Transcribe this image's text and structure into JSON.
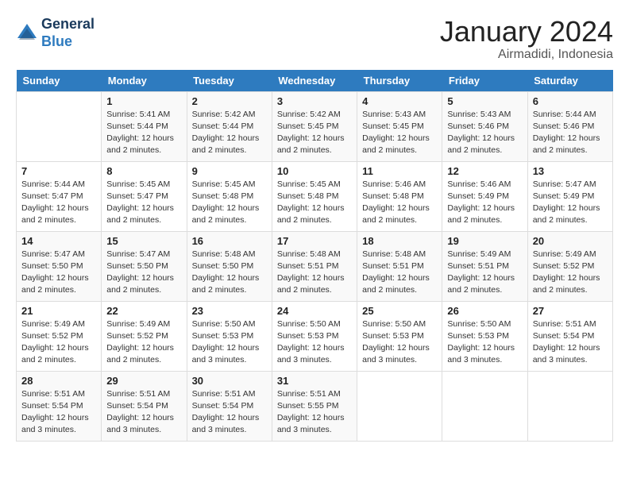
{
  "header": {
    "logo_line1": "General",
    "logo_line2": "Blue",
    "month": "January 2024",
    "location": "Airmadidi, Indonesia"
  },
  "weekdays": [
    "Sunday",
    "Monday",
    "Tuesday",
    "Wednesday",
    "Thursday",
    "Friday",
    "Saturday"
  ],
  "weeks": [
    [
      {
        "day": "",
        "info": ""
      },
      {
        "day": "1",
        "info": "Sunrise: 5:41 AM\nSunset: 5:44 PM\nDaylight: 12 hours\nand 2 minutes."
      },
      {
        "day": "2",
        "info": "Sunrise: 5:42 AM\nSunset: 5:44 PM\nDaylight: 12 hours\nand 2 minutes."
      },
      {
        "day": "3",
        "info": "Sunrise: 5:42 AM\nSunset: 5:45 PM\nDaylight: 12 hours\nand 2 minutes."
      },
      {
        "day": "4",
        "info": "Sunrise: 5:43 AM\nSunset: 5:45 PM\nDaylight: 12 hours\nand 2 minutes."
      },
      {
        "day": "5",
        "info": "Sunrise: 5:43 AM\nSunset: 5:46 PM\nDaylight: 12 hours\nand 2 minutes."
      },
      {
        "day": "6",
        "info": "Sunrise: 5:44 AM\nSunset: 5:46 PM\nDaylight: 12 hours\nand 2 minutes."
      }
    ],
    [
      {
        "day": "7",
        "info": "Sunrise: 5:44 AM\nSunset: 5:47 PM\nDaylight: 12 hours\nand 2 minutes."
      },
      {
        "day": "8",
        "info": "Sunrise: 5:45 AM\nSunset: 5:47 PM\nDaylight: 12 hours\nand 2 minutes."
      },
      {
        "day": "9",
        "info": "Sunrise: 5:45 AM\nSunset: 5:48 PM\nDaylight: 12 hours\nand 2 minutes."
      },
      {
        "day": "10",
        "info": "Sunrise: 5:45 AM\nSunset: 5:48 PM\nDaylight: 12 hours\nand 2 minutes."
      },
      {
        "day": "11",
        "info": "Sunrise: 5:46 AM\nSunset: 5:48 PM\nDaylight: 12 hours\nand 2 minutes."
      },
      {
        "day": "12",
        "info": "Sunrise: 5:46 AM\nSunset: 5:49 PM\nDaylight: 12 hours\nand 2 minutes."
      },
      {
        "day": "13",
        "info": "Sunrise: 5:47 AM\nSunset: 5:49 PM\nDaylight: 12 hours\nand 2 minutes."
      }
    ],
    [
      {
        "day": "14",
        "info": "Sunrise: 5:47 AM\nSunset: 5:50 PM\nDaylight: 12 hours\nand 2 minutes."
      },
      {
        "day": "15",
        "info": "Sunrise: 5:47 AM\nSunset: 5:50 PM\nDaylight: 12 hours\nand 2 minutes."
      },
      {
        "day": "16",
        "info": "Sunrise: 5:48 AM\nSunset: 5:50 PM\nDaylight: 12 hours\nand 2 minutes."
      },
      {
        "day": "17",
        "info": "Sunrise: 5:48 AM\nSunset: 5:51 PM\nDaylight: 12 hours\nand 2 minutes."
      },
      {
        "day": "18",
        "info": "Sunrise: 5:48 AM\nSunset: 5:51 PM\nDaylight: 12 hours\nand 2 minutes."
      },
      {
        "day": "19",
        "info": "Sunrise: 5:49 AM\nSunset: 5:51 PM\nDaylight: 12 hours\nand 2 minutes."
      },
      {
        "day": "20",
        "info": "Sunrise: 5:49 AM\nSunset: 5:52 PM\nDaylight: 12 hours\nand 2 minutes."
      }
    ],
    [
      {
        "day": "21",
        "info": "Sunrise: 5:49 AM\nSunset: 5:52 PM\nDaylight: 12 hours\nand 2 minutes."
      },
      {
        "day": "22",
        "info": "Sunrise: 5:49 AM\nSunset: 5:52 PM\nDaylight: 12 hours\nand 2 minutes."
      },
      {
        "day": "23",
        "info": "Sunrise: 5:50 AM\nSunset: 5:53 PM\nDaylight: 12 hours\nand 3 minutes."
      },
      {
        "day": "24",
        "info": "Sunrise: 5:50 AM\nSunset: 5:53 PM\nDaylight: 12 hours\nand 3 minutes."
      },
      {
        "day": "25",
        "info": "Sunrise: 5:50 AM\nSunset: 5:53 PM\nDaylight: 12 hours\nand 3 minutes."
      },
      {
        "day": "26",
        "info": "Sunrise: 5:50 AM\nSunset: 5:53 PM\nDaylight: 12 hours\nand 3 minutes."
      },
      {
        "day": "27",
        "info": "Sunrise: 5:51 AM\nSunset: 5:54 PM\nDaylight: 12 hours\nand 3 minutes."
      }
    ],
    [
      {
        "day": "28",
        "info": "Sunrise: 5:51 AM\nSunset: 5:54 PM\nDaylight: 12 hours\nand 3 minutes."
      },
      {
        "day": "29",
        "info": "Sunrise: 5:51 AM\nSunset: 5:54 PM\nDaylight: 12 hours\nand 3 minutes."
      },
      {
        "day": "30",
        "info": "Sunrise: 5:51 AM\nSunset: 5:54 PM\nDaylight: 12 hours\nand 3 minutes."
      },
      {
        "day": "31",
        "info": "Sunrise: 5:51 AM\nSunset: 5:55 PM\nDaylight: 12 hours\nand 3 minutes."
      },
      {
        "day": "",
        "info": ""
      },
      {
        "day": "",
        "info": ""
      },
      {
        "day": "",
        "info": ""
      }
    ]
  ]
}
